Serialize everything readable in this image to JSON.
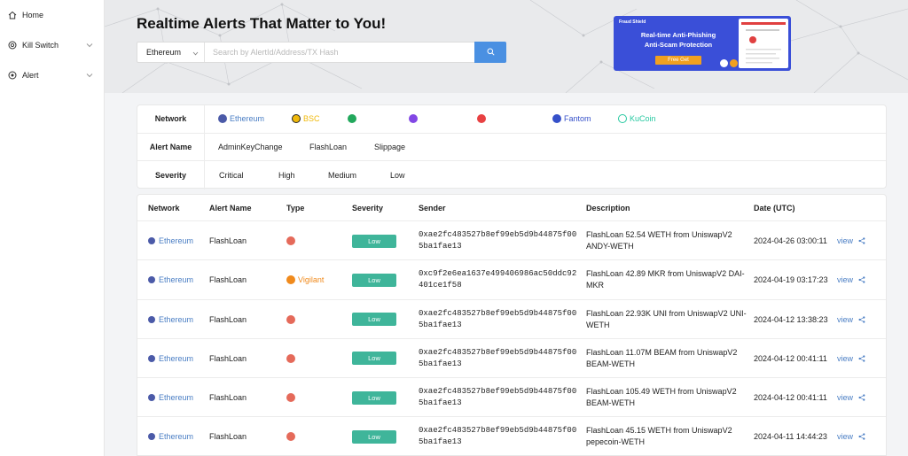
{
  "sidebar": {
    "items": [
      {
        "label": "Home",
        "icon": "home-icon"
      },
      {
        "label": "Kill Switch",
        "icon": "kill-switch-icon"
      },
      {
        "label": "Alert",
        "icon": "alert-icon"
      }
    ]
  },
  "hero": {
    "title": "Realtime Alerts That Matter to You!",
    "network_select": "Ethereum",
    "search_placeholder": "Search by AlertId/Address/TX Hash",
    "ad": {
      "logo": "Fraud Shield",
      "line1": "Real-time Anti-Phishing",
      "line2": "Anti-Scam Protection",
      "button": "Free Get"
    }
  },
  "filters": {
    "network_label": "Network",
    "networks": [
      "Ethereum",
      "BSC",
      "",
      "",
      "",
      "Fantom",
      "KuCoin"
    ],
    "alert_label": "Alert Name",
    "alerts": [
      "AdminKeyChange",
      "FlashLoan",
      "Slippage"
    ],
    "severity_label": "Severity",
    "severities": [
      "Critical",
      "High",
      "Medium",
      "Low"
    ]
  },
  "table": {
    "headers": [
      "Network",
      "Alert Name",
      "Type",
      "Severity",
      "Sender",
      "Description",
      "Date (UTC)"
    ],
    "rows": [
      {
        "network": "Ethereum",
        "alert": "FlashLoan",
        "type": "",
        "severity": "Low",
        "sender1": "0xae2fc483527b8ef99eb5d9b44875f00",
        "sender2": "5ba1fae13",
        "desc1": "FlashLoan 52.54 WETH from UniswapV2",
        "desc2": "ANDY-WETH",
        "date": "2024-04-26 03:00:11",
        "view": "view"
      },
      {
        "network": "Ethereum",
        "alert": "FlashLoan",
        "type": "Vigilant",
        "severity": "Low",
        "sender1": "0xc9f2e6ea1637e499406986ac50ddc92",
        "sender2": "401ce1f58",
        "desc1": "FlashLoan 42.89 MKR from UniswapV2 DAI-",
        "desc2": "MKR",
        "date": "2024-04-19 03:17:23",
        "view": "view"
      },
      {
        "network": "Ethereum",
        "alert": "FlashLoan",
        "type": "",
        "severity": "Low",
        "sender1": "0xae2fc483527b8ef99eb5d9b44875f00",
        "sender2": "5ba1fae13",
        "desc1": "FlashLoan 22.93K UNI from UniswapV2 UNI-",
        "desc2": "WETH",
        "date": "2024-04-12 13:38:23",
        "view": "view"
      },
      {
        "network": "Ethereum",
        "alert": "FlashLoan",
        "type": "",
        "severity": "Low",
        "sender1": "0xae2fc483527b8ef99eb5d9b44875f00",
        "sender2": "5ba1fae13",
        "desc1": "FlashLoan 11.07M BEAM from UniswapV2",
        "desc2": "BEAM-WETH",
        "date": "2024-04-12 00:41:11",
        "view": "view"
      },
      {
        "network": "Ethereum",
        "alert": "FlashLoan",
        "type": "",
        "severity": "Low",
        "sender1": "0xae2fc483527b8ef99eb5d9b44875f00",
        "sender2": "5ba1fae13",
        "desc1": "FlashLoan 105.49 WETH from UniswapV2",
        "desc2": "BEAM-WETH",
        "date": "2024-04-12 00:41:11",
        "view": "view"
      },
      {
        "network": "Ethereum",
        "alert": "FlashLoan",
        "type": "",
        "severity": "Low",
        "sender1": "0xae2fc483527b8ef99eb5d9b44875f00",
        "sender2": "5ba1fae13",
        "desc1": "FlashLoan 45.15 WETH from UniswapV2",
        "desc2": "pepecoin-WETH",
        "date": "2024-04-11 14:44:23",
        "view": "view"
      }
    ]
  },
  "colors": {
    "accent": "#4a90e2",
    "link": "#4a7ec4",
    "badge_low": "#3fb59a",
    "vigilant": "#f08a1c",
    "type_alert": "#e56a5a",
    "ad_bg": "#3a4fd8"
  }
}
